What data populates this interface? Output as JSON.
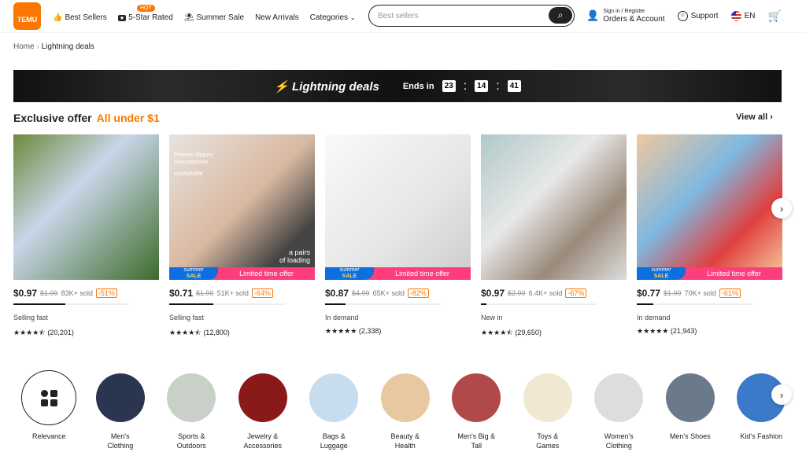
{
  "header": {
    "logo": "TEMU",
    "nav": [
      {
        "label": "Best Sellers",
        "icon": "thumbs-up-icon",
        "badge": "HOT"
      },
      {
        "label": "5-Star Rated",
        "icon": "star-badge-icon"
      },
      {
        "label": "Summer Sale",
        "icon": "palm-tree-icon"
      },
      {
        "label": "New Arrivals"
      },
      {
        "label": "Categories",
        "icon": "chevron-down-icon"
      }
    ],
    "search_placeholder": "Best sellers",
    "account_top": "Sign in / Register",
    "account_bottom": "Orders & Account",
    "support": "Support",
    "language": "EN"
  },
  "breadcrumb": {
    "home": "Home",
    "sep": "›",
    "current": "Lightning deals"
  },
  "banner": {
    "title": "Lightning deals",
    "ends_in": "Ends in",
    "hours": "23",
    "minutes": "14",
    "seconds": "41"
  },
  "section": {
    "title": "Exclusive offer",
    "highlight": "All under $1",
    "view_all": "View all",
    "accent": "#fb7701"
  },
  "products": [
    {
      "price": "$0.97",
      "orig": "$1.99",
      "sold": "83K+ sold",
      "discount": "-51%",
      "progress": 45,
      "tag": "Selling fast",
      "stars": "★★★★⯪",
      "reviews": "(20,201)",
      "promo": false
    },
    {
      "price": "$0.71",
      "orig": "$1.99",
      "sold": "51K+ sold",
      "discount": "-64%",
      "progress": 38,
      "tag": "Selling fast",
      "stars": "★★★★⯪",
      "reviews": "(12,800)",
      "promo": true,
      "overlay": [
        "Prevent slippery",
        "slow pressure",
        "comfortable",
        "a pairs",
        "of loading"
      ]
    },
    {
      "price": "$0.87",
      "orig": "$4.99",
      "sold": "65K+ sold",
      "discount": "-82%",
      "progress": 18,
      "tag": "In demand",
      "stars": "★★★★★",
      "reviews": "(2,338)",
      "promo": true
    },
    {
      "price": "$0.97",
      "orig": "$2.99",
      "sold": "6.4K+ sold",
      "discount": "-67%",
      "progress": 5,
      "tag": "New in",
      "stars": "★★★★⯪",
      "reviews": "(29,650)",
      "promo": false
    },
    {
      "price": "$0.77",
      "orig": "$1.99",
      "sold": "70K+ sold",
      "discount": "-61%",
      "progress": 14,
      "tag": "In demand",
      "stars": "★★★★★",
      "reviews": "(21,943)",
      "promo": true
    }
  ],
  "promo": {
    "summer": "summer",
    "sale": "SALE",
    "limited": "Limited time offer"
  },
  "categories": [
    {
      "l1": "Relevance",
      "l2": ""
    },
    {
      "l1": "Men's",
      "l2": "Clothing"
    },
    {
      "l1": "Sports &",
      "l2": "Outdoors"
    },
    {
      "l1": "Jewelry &",
      "l2": "Accessories"
    },
    {
      "l1": "Bags &",
      "l2": "Luggage"
    },
    {
      "l1": "Beauty &",
      "l2": "Health"
    },
    {
      "l1": "Men's Big &",
      "l2": "Tall"
    },
    {
      "l1": "Toys &",
      "l2": "Games"
    },
    {
      "l1": "Women's",
      "l2": "Clothing"
    },
    {
      "l1": "Men's Shoes",
      "l2": ""
    },
    {
      "l1": "Kid's Fashion",
      "l2": ""
    }
  ]
}
